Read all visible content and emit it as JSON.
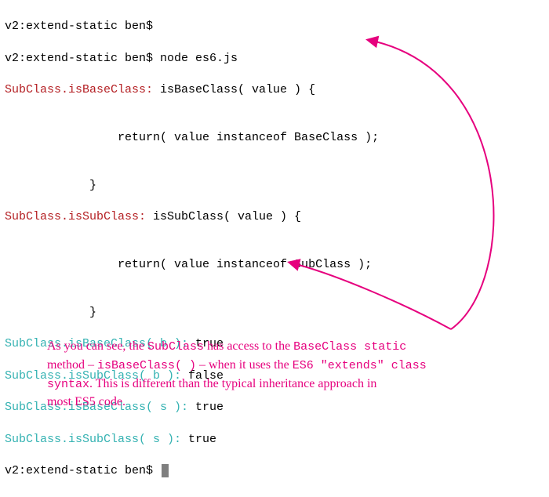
{
  "terminal": {
    "line1_prompt": "v2:extend-static ben$ ",
    "line2_prompt": "v2:extend-static ben$ ",
    "line2_cmd": "node es6.js",
    "line3_label": "SubClass.isBaseClass:",
    "line3_rest": " isBaseClass( value ) {",
    "line4": "",
    "line5": "                return( value instanceof BaseClass );",
    "line6": "",
    "line7": "            }",
    "line8_label": "SubClass.isSubClass:",
    "line8_rest": " isSubClass( value ) {",
    "line9": "",
    "line10": "                return( value instanceof SubClass );",
    "line11": "",
    "line12": "            }",
    "line13_call": "SubClass.isBaseClass( b ):",
    "line13_res": " true",
    "line14_call": "SubClass.isSubClass( b ):",
    "line14_res": " false",
    "line15_call": "SubClass.isBaseClass( s ):",
    "line15_res": " true",
    "line16_call": "SubClass.isSubClass( s ):",
    "line16_res": " true",
    "line17_prompt": "v2:extend-static ben$ "
  },
  "annotation": {
    "p1a": "As you can see, the ",
    "p1b": "SubClass",
    "p1c": " has access to the ",
    "p1d": "BaseClass static",
    "p2a": "method – ",
    "p2b": "isBaseClass( )",
    "p2c": "  – when it uses the ",
    "p2d": "ES6 \"extends\" class",
    "p3a": "syntax",
    "p3b": ". This is different than the typical inheritance approach in",
    "p4": "most ES5 code."
  },
  "colors": {
    "accent": "#e6007e",
    "red": "#b41f23",
    "teal": "#34b2b2"
  }
}
